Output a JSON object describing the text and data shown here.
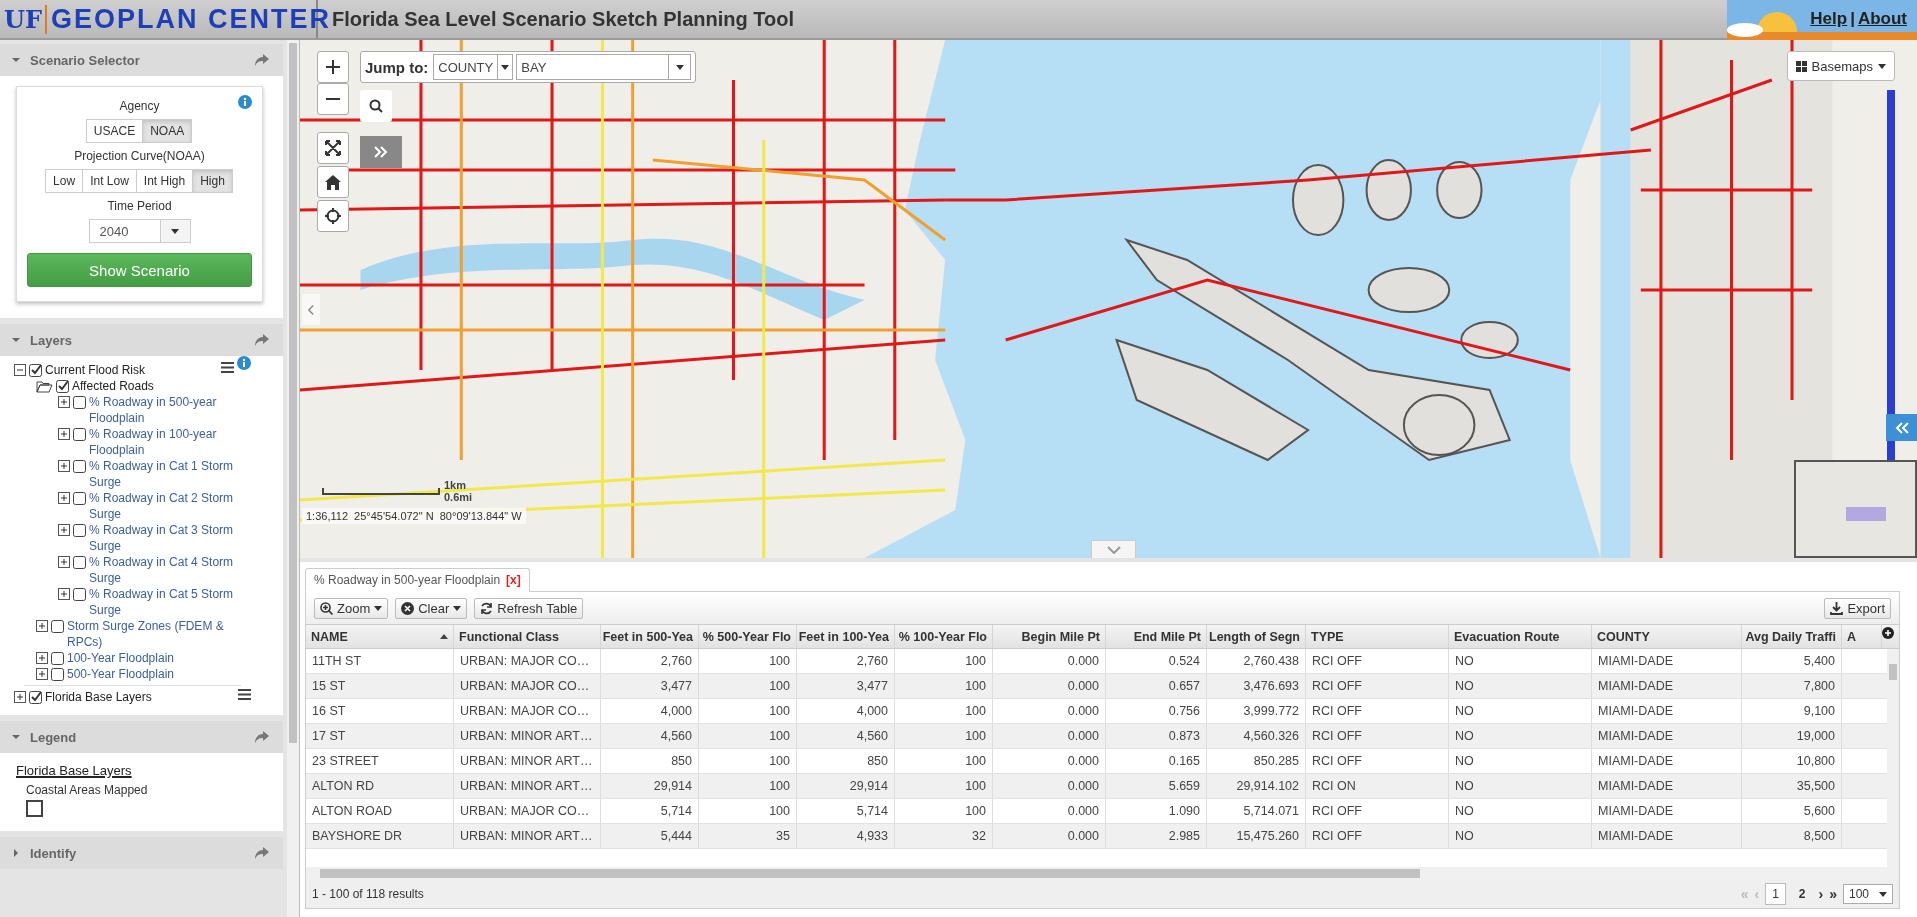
{
  "header": {
    "logo": {
      "uf": "UF",
      "name": "GEOPLAN CENTER"
    },
    "title": "Florida Sea Level Scenario Sketch Planning Tool",
    "links": [
      {
        "label": "Help"
      },
      {
        "label": "About"
      }
    ],
    "separator": "|"
  },
  "scenario_selector": {
    "title": "Scenario Selector",
    "expanded": true,
    "agency": {
      "label": "Agency",
      "options": [
        {
          "label": "USACE",
          "selected": false
        },
        {
          "label": "NOAA",
          "selected": true
        }
      ]
    },
    "projection_curve": {
      "label": "Projection Curve(NOAA)",
      "options": [
        {
          "label": "Low",
          "selected": false
        },
        {
          "label": "Int Low",
          "selected": false
        },
        {
          "label": "Int High",
          "selected": false
        },
        {
          "label": "High",
          "selected": true
        }
      ]
    },
    "time_period": {
      "label": "Time Period",
      "value": "2040"
    },
    "submit": "Show Scenario"
  },
  "layers": {
    "title": "Layers",
    "expanded": true,
    "tree": [
      {
        "label": "Current Flood Risk",
        "kind": "group",
        "checked": true,
        "expanded": true,
        "menu": true,
        "info": true,
        "children": [
          {
            "label": "Affected Roads",
            "kind": "folder",
            "checked": true,
            "expanded": true,
            "children": [
              {
                "label": "% Roadway in 500-year Floodplain",
                "kind": "layer",
                "checked": false,
                "expanded": false
              },
              {
                "label": "% Roadway in 100-year Floodplain",
                "kind": "layer",
                "checked": false,
                "expanded": false
              },
              {
                "label": "% Roadway in Cat 1 Storm Surge",
                "kind": "layer",
                "checked": false,
                "expanded": false
              },
              {
                "label": "% Roadway in Cat 2 Storm Surge",
                "kind": "layer",
                "checked": false,
                "expanded": false
              },
              {
                "label": "% Roadway in Cat 3 Storm Surge",
                "kind": "layer",
                "checked": false,
                "expanded": false
              },
              {
                "label": "% Roadway in Cat 4 Storm Surge",
                "kind": "layer",
                "checked": false,
                "expanded": false
              },
              {
                "label": "% Roadway in Cat 5 Storm Surge",
                "kind": "layer",
                "checked": false,
                "expanded": false
              }
            ]
          },
          {
            "label": "Storm Surge Zones (FDEM & RPCs)",
            "kind": "layer",
            "checked": false,
            "expanded": false
          },
          {
            "label": "100-Year Floodplain",
            "kind": "layer",
            "checked": false,
            "expanded": false
          },
          {
            "label": "500-Year Floodplain",
            "kind": "layer",
            "checked": false,
            "expanded": false
          }
        ]
      },
      {
        "label": "Florida Base Layers",
        "kind": "group",
        "checked": true,
        "expanded": false,
        "menu": true,
        "info": false
      }
    ]
  },
  "legend": {
    "title": "Legend",
    "expanded": true,
    "group": "Florida Base Layers",
    "items": [
      {
        "label": "Coastal Areas Mapped"
      }
    ]
  },
  "identify": {
    "title": "Identify",
    "expanded": false
  },
  "map": {
    "jump_to": {
      "label": "Jump to:",
      "type": "COUNTY",
      "place": "BAY"
    },
    "basemaps": "Basemaps",
    "scale": {
      "km": "1km",
      "mi": "0.6mi"
    },
    "coordinates": "1:36,112  25°45'54.072\" N  80°09'13.844\" W"
  },
  "table": {
    "tabs": [
      {
        "label": "% Roadway in 500-year Floodplain",
        "close": "[x]",
        "selected": true
      }
    ],
    "toolbar": {
      "zoom": "Zoom",
      "clear": "Clear",
      "refresh": "Refresh Table",
      "export": "Export"
    },
    "columns": [
      {
        "label": "NAME",
        "sorted": true
      },
      {
        "label": "Functional Class",
        "sorted": false
      },
      {
        "label": "Feet in 500-Yea",
        "sorted": false
      },
      {
        "label": "% 500-Year Flo",
        "sorted": false
      },
      {
        "label": "Feet in 100-Yea",
        "sorted": false
      },
      {
        "label": "% 100-Year Flo",
        "sorted": false
      },
      {
        "label": "Begin Mile Pt",
        "sorted": false
      },
      {
        "label": "End Mile Pt",
        "sorted": false
      },
      {
        "label": "Length of Segn",
        "sorted": false
      },
      {
        "label": "TYPE",
        "sorted": false
      },
      {
        "label": "Evacuation Route",
        "sorted": false
      },
      {
        "label": "COUNTY",
        "sorted": false
      },
      {
        "label": "Avg Daily Traffi",
        "sorted": false
      },
      {
        "label": "A",
        "sorted": false
      }
    ],
    "rows": [
      [
        "11TH ST",
        "URBAN: MAJOR CO…",
        "2,760",
        "100",
        "2,760",
        "100",
        "0.000",
        "0.524",
        "2,760.438",
        "RCI OFF",
        "NO",
        "MIAMI-DADE",
        "5,400"
      ],
      [
        "15 ST",
        "URBAN: MAJOR CO…",
        "3,477",
        "100",
        "3,477",
        "100",
        "0.000",
        "0.657",
        "3,476.693",
        "RCI OFF",
        "NO",
        "MIAMI-DADE",
        "7,800"
      ],
      [
        "16 ST",
        "URBAN: MAJOR CO…",
        "4,000",
        "100",
        "4,000",
        "100",
        "0.000",
        "0.756",
        "3,999.772",
        "RCI OFF",
        "NO",
        "MIAMI-DADE",
        "9,100"
      ],
      [
        "17 ST",
        "URBAN: MINOR ART…",
        "4,560",
        "100",
        "4,560",
        "100",
        "0.000",
        "0.873",
        "4,560.326",
        "RCI OFF",
        "NO",
        "MIAMI-DADE",
        "19,000"
      ],
      [
        "23 STREET",
        "URBAN: MINOR ART…",
        "850",
        "100",
        "850",
        "100",
        "0.000",
        "0.165",
        "850.285",
        "RCI OFF",
        "NO",
        "MIAMI-DADE",
        "10,800"
      ],
      [
        "ALTON RD",
        "URBAN: MINOR ART…",
        "29,914",
        "100",
        "29,914",
        "100",
        "0.000",
        "5.659",
        "29,914.102",
        "RCI ON",
        "NO",
        "MIAMI-DADE",
        "35,500"
      ],
      [
        "ALTON ROAD",
        "URBAN: MAJOR CO…",
        "5,714",
        "100",
        "5,714",
        "100",
        "0.000",
        "1.090",
        "5,714.071",
        "RCI OFF",
        "NO",
        "MIAMI-DADE",
        "5,600"
      ],
      [
        "BAYSHORE DR",
        "URBAN: MINOR ART…",
        "5,444",
        "35",
        "4,933",
        "32",
        "0.000",
        "2.985",
        "15,475.260",
        "RCI OFF",
        "NO",
        "MIAMI-DADE",
        "8,500"
      ]
    ],
    "status": "1 - 100 of 118 results",
    "pagination": {
      "first": "«",
      "prev": "‹",
      "pages": [
        {
          "label": "1",
          "selected": true
        },
        {
          "label": "2",
          "selected": false
        }
      ],
      "next": "›",
      "last": "»",
      "page_size": "100"
    }
  }
}
